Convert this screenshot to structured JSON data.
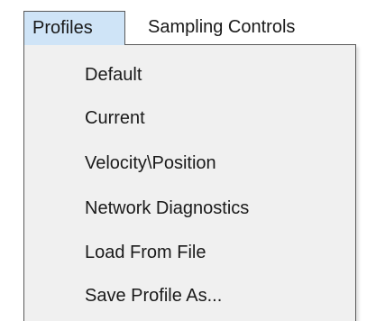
{
  "menubar": {
    "menus": [
      {
        "label": "Profiles"
      },
      {
        "label": "Sampling Controls"
      }
    ]
  },
  "dropdown": {
    "items": [
      {
        "label": "Default"
      },
      {
        "label": "Current"
      },
      {
        "label": "Velocity\\Position"
      },
      {
        "label": "Network Diagnostics"
      },
      {
        "label": "Load From File"
      },
      {
        "label": "Save Profile As..."
      }
    ]
  },
  "colors": {
    "active_menu_bg": "#cfe4f7",
    "dropdown_bg": "#f0f0f0",
    "border": "#5a5a5a"
  }
}
